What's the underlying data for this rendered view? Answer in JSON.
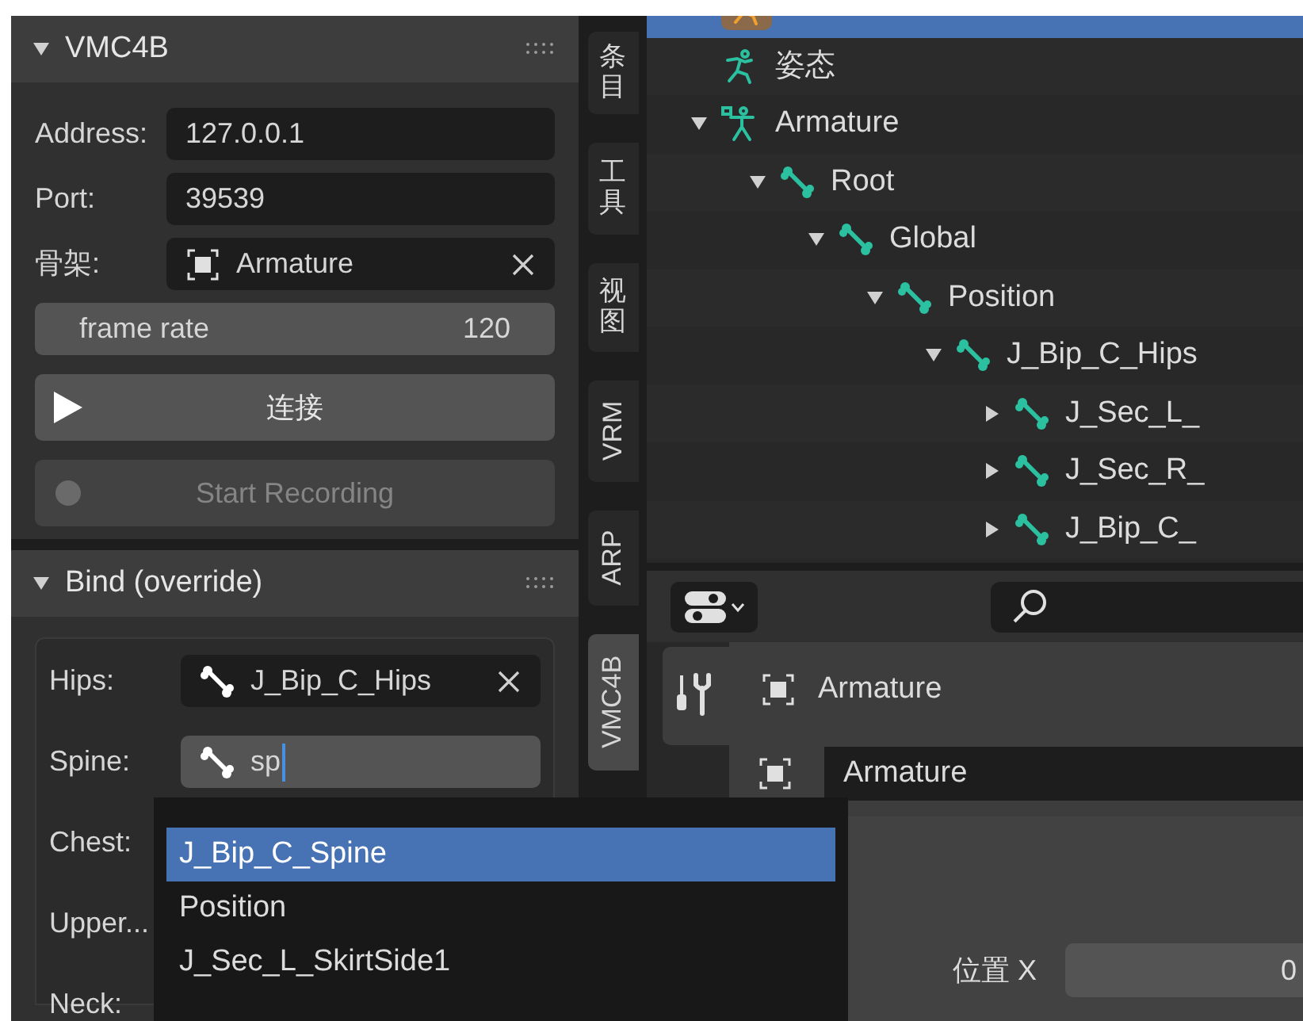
{
  "panels": [
    {
      "title": "VMC4B",
      "expanded": true,
      "rows": [
        {
          "kind": "field",
          "label": "Address:",
          "value": "127.0.0.1"
        },
        {
          "kind": "field",
          "label": "Port:",
          "value": "39539"
        },
        {
          "kind": "object",
          "label": "骨架:",
          "value": "Armature"
        },
        {
          "kind": "number",
          "label": "frame rate",
          "value": "120"
        },
        {
          "kind": "play",
          "label": "连接",
          "disabled": false
        },
        {
          "kind": "record",
          "label": "Start Recording",
          "disabled": true
        }
      ]
    },
    {
      "title": "Bind (override)",
      "expanded": true,
      "rows": [
        {
          "kind": "bone",
          "label": "Hips:",
          "value": "J_Bip_C_Hips",
          "editing": false
        },
        {
          "kind": "bone",
          "label": "Spine:",
          "value": "sp",
          "editing": true
        },
        {
          "kind": "covered",
          "label": "Chest:"
        },
        {
          "kind": "covered",
          "label": "Upper..."
        },
        {
          "kind": "covered",
          "label": "Neck:"
        }
      ]
    }
  ],
  "dropdown": {
    "items": [
      {
        "label": "J_Bip_C_Spine",
        "selected": true
      },
      {
        "label": "Position",
        "selected": false
      },
      {
        "label": "J_Sec_L_SkirtSide1",
        "selected": false
      }
    ]
  },
  "tabs": [
    {
      "label": "条目",
      "selected": false
    },
    {
      "label": "工具",
      "selected": false
    },
    {
      "label": "视图",
      "selected": false
    },
    {
      "label": "VRM",
      "selected": false
    },
    {
      "label": "ARP",
      "selected": false
    },
    {
      "label": "VMC4B",
      "selected": true
    }
  ],
  "outliner": {
    "items": [
      {
        "kind": "object",
        "selected": true,
        "children": [
          {
            "label": "姿态",
            "kind": "pose",
            "selected": false
          },
          {
            "label": "Armature",
            "kind": "armature",
            "selected": false,
            "expanded": true,
            "children": [
              {
                "label": "Root",
                "kind": "bone",
                "selected": false,
                "expanded": true,
                "children": [
                  {
                    "label": "Global",
                    "kind": "bone",
                    "selected": false,
                    "expanded": true,
                    "children": [
                      {
                        "label": "Position",
                        "kind": "bone",
                        "selected": false,
                        "expanded": true,
                        "children": [
                          {
                            "label": "J_Bip_C_Hips",
                            "kind": "bone",
                            "selected": false,
                            "expanded": true,
                            "children": [
                              {
                                "label": "J_Sec_L_",
                                "kind": "bone",
                                "selected": false,
                                "expanded": false
                              },
                              {
                                "label": "J_Sec_R_",
                                "kind": "bone",
                                "selected": false,
                                "expanded": false
                              },
                              {
                                "label": "J_Bip_C_",
                                "kind": "bone",
                                "selected": false,
                                "expanded": false
                              }
                            ]
                          }
                        ]
                      }
                    ]
                  }
                ]
              }
            ]
          }
        ]
      }
    ]
  },
  "properties": {
    "object_name": "Armature",
    "data_field": "Armature",
    "rows": [
      {
        "label": "位置 X",
        "value": "0"
      }
    ]
  }
}
